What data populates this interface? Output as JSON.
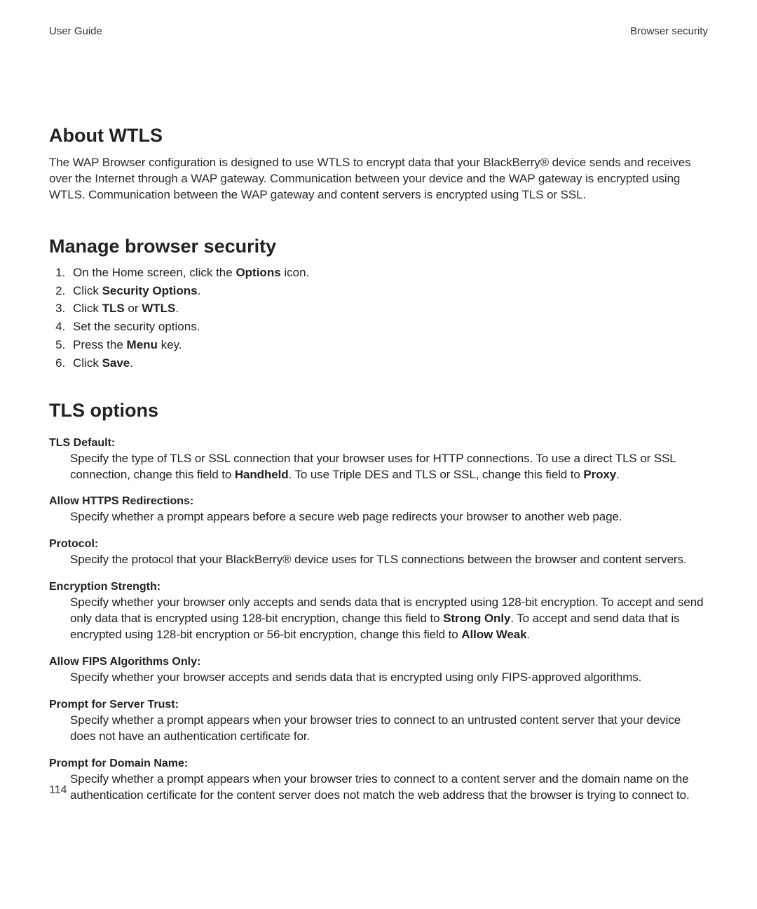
{
  "header": {
    "left": "User Guide",
    "right": "Browser security"
  },
  "section_about": {
    "title": "About WTLS",
    "body": "The WAP Browser configuration is designed to use WTLS to encrypt data that your BlackBerry® device sends and receives over the Internet through a WAP gateway. Communication between your device and the WAP gateway is encrypted using WTLS. Communication between the WAP gateway and content servers is encrypted using TLS or SSL."
  },
  "section_manage": {
    "title": "Manage browser security",
    "steps": [
      {
        "pre": "On the Home screen, click the ",
        "bold": "Options",
        "post": " icon."
      },
      {
        "pre": "Click ",
        "bold": "Security Options",
        "post": "."
      },
      {
        "pre": "Click ",
        "bold": "TLS",
        "mid": " or ",
        "bold2": "WTLS",
        "post": "."
      },
      {
        "pre": "Set the security options.",
        "bold": "",
        "post": ""
      },
      {
        "pre": "Press the ",
        "bold": "Menu",
        "post": " key."
      },
      {
        "pre": "Click ",
        "bold": "Save",
        "post": "."
      }
    ]
  },
  "section_tls": {
    "title": "TLS options",
    "options": [
      {
        "label": "TLS Default:",
        "d1": "Specify the type of TLS or SSL connection that your browser uses for HTTP connections. To use a direct TLS or SSL connection, change this field to ",
        "b1": "Handheld",
        "d2": ". To use Triple DES and TLS or SSL, change this field to ",
        "b2": "Proxy",
        "d3": "."
      },
      {
        "label": "Allow HTTPS Redirections:",
        "d1": "Specify whether a prompt appears before a secure web page redirects your browser to another web page.",
        "b1": "",
        "d2": "",
        "b2": "",
        "d3": ""
      },
      {
        "label": "Protocol:",
        "d1": "Specify the protocol that your BlackBerry® device uses for TLS connections between the browser and content servers.",
        "b1": "",
        "d2": "",
        "b2": "",
        "d3": ""
      },
      {
        "label": "Encryption Strength:",
        "d1": "Specify whether your browser only accepts and sends data that is encrypted using 128-bit encryption. To accept and send only data that is encrypted using 128-bit encryption, change this field to ",
        "b1": "Strong Only",
        "d2": ". To accept and send data that is encrypted using 128-bit encryption or 56-bit encryption, change this field to ",
        "b2": "Allow Weak",
        "d3": "."
      },
      {
        "label": "Allow FIPS Algorithms Only:",
        "d1": "Specify whether your browser accepts and sends data that is encrypted using only FIPS-approved algorithms.",
        "b1": "",
        "d2": "",
        "b2": "",
        "d3": ""
      },
      {
        "label": "Prompt for Server Trust:",
        "d1": "Specify whether a prompt appears when your browser tries to connect to an untrusted content server that your device does not have an authentication certificate for.",
        "b1": "",
        "d2": "",
        "b2": "",
        "d3": ""
      },
      {
        "label": "Prompt for Domain Name:",
        "d1": "Specify whether a prompt appears when your browser tries to connect to a content server and the domain name on the authentication certificate for the content server does not match the web address that the browser is trying to connect to.",
        "b1": "",
        "d2": "",
        "b2": "",
        "d3": ""
      }
    ]
  },
  "page_number": "114"
}
